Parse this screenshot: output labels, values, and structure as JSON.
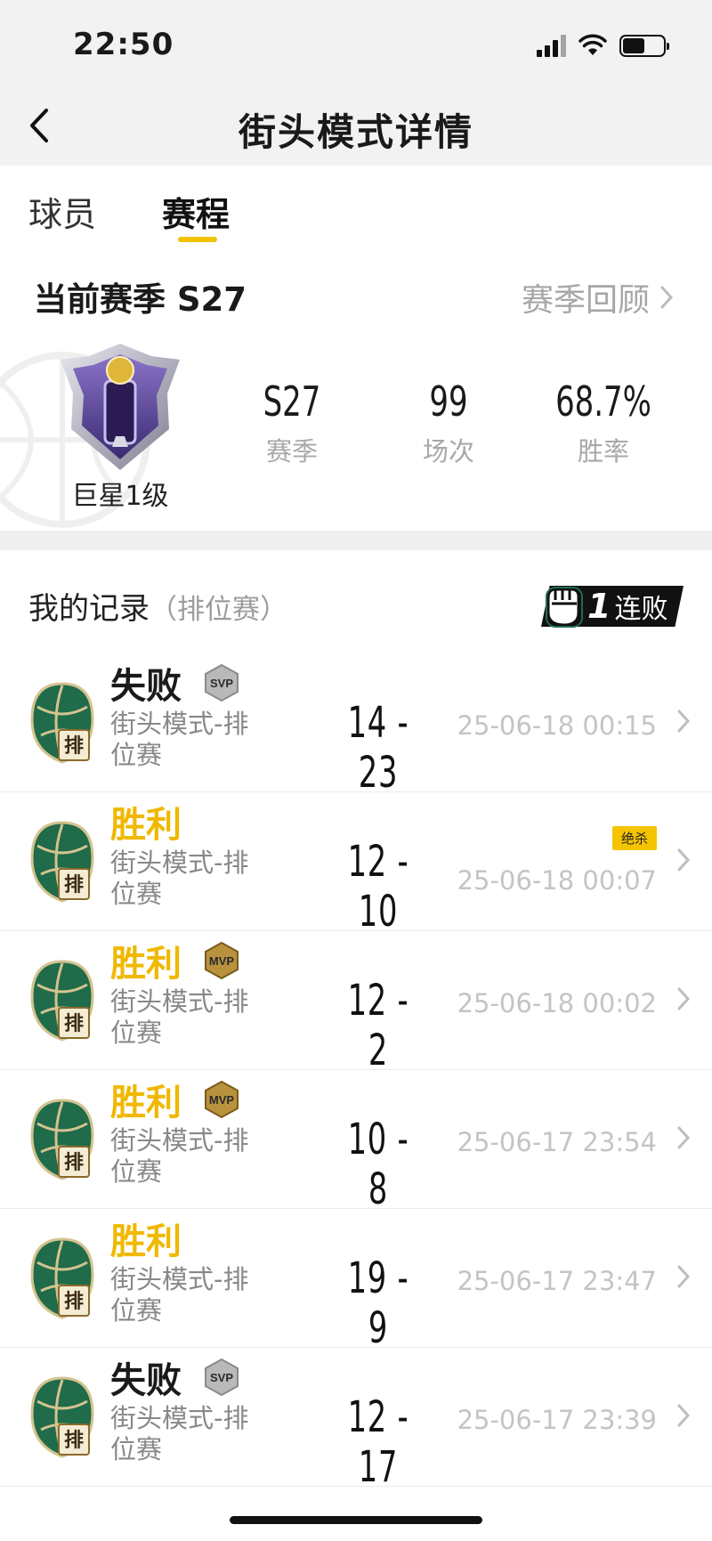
{
  "status_bar": {
    "time": "22:50"
  },
  "nav": {
    "title": "街头模式详情"
  },
  "tabs": [
    {
      "label": "球员"
    },
    {
      "label": "赛程"
    }
  ],
  "season": {
    "title": "当前赛季 S27",
    "review_label": "赛季回顾",
    "rank": "巨星1级",
    "stats": [
      {
        "value": "S27",
        "label": "赛季"
      },
      {
        "value": "99",
        "label": "场次"
      },
      {
        "value": "68.7%",
        "label": "胜率"
      }
    ]
  },
  "records": {
    "title": "我的记录",
    "subtitle": "（排位赛）",
    "streak_count": "1",
    "streak_label": "连败",
    "matches": [
      {
        "result": "失败",
        "status": "lose",
        "badge": "SVP",
        "mode": "街头模式-排位赛",
        "score": "14 - 23",
        "date": "25-06-18 00:15",
        "tag": ""
      },
      {
        "result": "胜利",
        "status": "win",
        "badge": "",
        "mode": "街头模式-排位赛",
        "score": "12 - 10",
        "date": "25-06-18 00:07",
        "tag": "绝杀"
      },
      {
        "result": "胜利",
        "status": "win",
        "badge": "MVP",
        "mode": "街头模式-排位赛",
        "score": "12 - 2",
        "date": "25-06-18 00:02",
        "tag": ""
      },
      {
        "result": "胜利",
        "status": "win",
        "badge": "MVP",
        "mode": "街头模式-排位赛",
        "score": "10 - 8",
        "date": "25-06-17 23:54",
        "tag": ""
      },
      {
        "result": "胜利",
        "status": "win",
        "badge": "",
        "mode": "街头模式-排位赛",
        "score": "19 - 9",
        "date": "25-06-17 23:47",
        "tag": ""
      },
      {
        "result": "失败",
        "status": "lose",
        "badge": "SVP",
        "mode": "街头模式-排位赛",
        "score": "12 - 17",
        "date": "25-06-17 23:39",
        "tag": ""
      }
    ],
    "mode_icon_char": "排"
  },
  "colors": {
    "accent": "#f2c200",
    "win": "#f0b800",
    "muted": "#a8a8a8",
    "team_green": "#1f6b4a"
  }
}
